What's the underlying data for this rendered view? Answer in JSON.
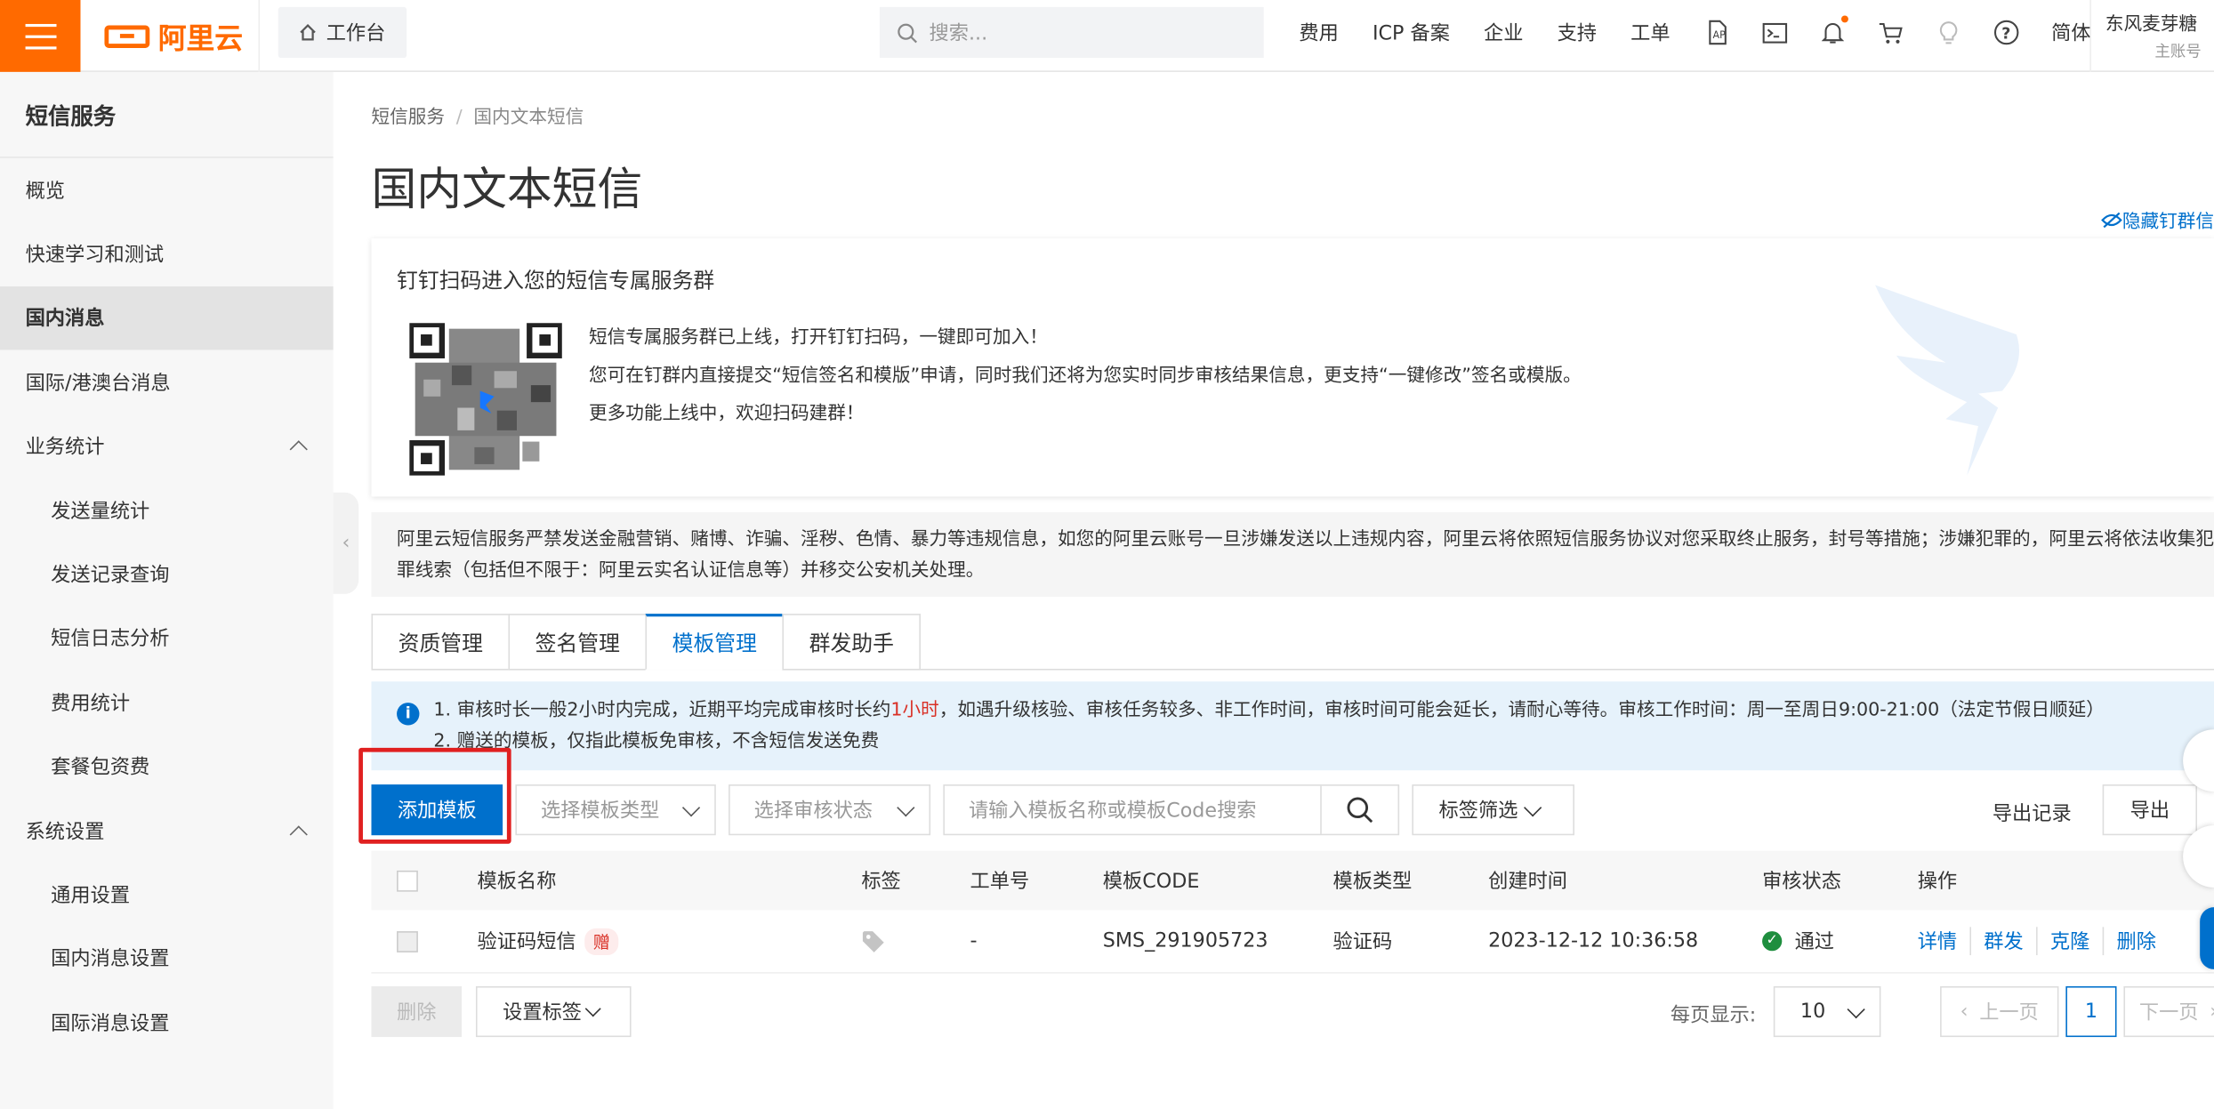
{
  "header": {
    "logo_text": "阿里云",
    "workbench": "工作台",
    "search_placeholder": "搜索...",
    "nav": [
      "费用",
      "ICP 备案",
      "企业",
      "支持",
      "工单"
    ],
    "lang": "简体",
    "user_name": "东风麦芽糖",
    "user_role": "主账号",
    "brand_color": "#ff6a00"
  },
  "sidebar": {
    "title": "短信服务",
    "items": [
      {
        "label": "概览"
      },
      {
        "label": "快速学习和测试"
      },
      {
        "label": "国内消息"
      },
      {
        "label": "国际/港澳台消息"
      },
      {
        "label": "业务统计"
      },
      {
        "label": "发送量统计"
      },
      {
        "label": "发送记录查询"
      },
      {
        "label": "短信日志分析"
      },
      {
        "label": "费用统计"
      },
      {
        "label": "套餐包资费"
      },
      {
        "label": "系统设置"
      },
      {
        "label": "通用设置"
      },
      {
        "label": "国内消息设置"
      },
      {
        "label": "国际消息设置"
      }
    ]
  },
  "breadcrumb": {
    "root": "短信服务",
    "sep": "/",
    "current": "国内文本短信"
  },
  "page_title": "国内文本短信",
  "hide_link": "隐藏钉群信",
  "dingtalk_card": {
    "heading": "钉钉扫码进入您的短信专属服务群",
    "line1": "短信专属服务群已上线，打开钉钉扫码，一键即可加入！",
    "line2": "您可在钉群内直接提交“短信签名和模版”申请，同时我们还将为您实时同步审核结果信息，更支持“一键修改”签名或模版。",
    "line3": "更多功能上线中，欢迎扫码建群！"
  },
  "warning": "阿里云短信服务严禁发送金融营销、赌博、诈骗、淫秽、色情、暴力等违规信息，如您的阿里云账号一旦涉嫌发送以上违规内容，阿里云将依照短信服务协议对您采取终止服务，封号等措施；涉嫌犯罪的，阿里云将依法收集犯罪线索（包括但不限于：阿里云实名认证信息等）并移交公安机关处理。",
  "tabs": [
    {
      "label": "资质管理"
    },
    {
      "label": "签名管理"
    },
    {
      "label": "模板管理"
    },
    {
      "label": "群发助手"
    }
  ],
  "notice": {
    "line1_prefix": "1. 审核时长一般2小时内完成，近期平均完成审核时长约",
    "line1_highlight": "1小时",
    "line1_suffix": "，如遇升级核验、审核任务较多、非工作时间，审核时间可能会延长，请耐心等待。审核工作时间：周一至周日9:00-21:00（法定节假日顺延）",
    "line2": "2. 赠送的模板，仅指此模板免审核，不含短信发送免费"
  },
  "toolbar": {
    "add_button": "添加模板",
    "type_placeholder": "选择模板类型",
    "status_placeholder": "选择审核状态",
    "search_placeholder": "请输入模板名称或模板Code搜索",
    "tag_filter": "标签筛选",
    "export_records": "导出记录",
    "export": "导出"
  },
  "table": {
    "columns": [
      "模板名称",
      "标签",
      "工单号",
      "模板CODE",
      "模板类型",
      "创建时间",
      "审核状态",
      "操作"
    ],
    "rows": [
      {
        "name": "验证码短信",
        "badge": "赠",
        "order_no": "-",
        "code": "SMS_291905723",
        "type": "验证码",
        "created": "2023-12-12 10:36:58",
        "status": "通过",
        "ops": [
          "详情",
          "群发",
          "克隆",
          "删除"
        ]
      }
    ]
  },
  "footer": {
    "delete": "删除",
    "set_tags": "设置标签",
    "per_page_label": "每页显示:",
    "per_page_value": "10",
    "prev": "上一页",
    "current_page": "1",
    "next": "下一页"
  }
}
